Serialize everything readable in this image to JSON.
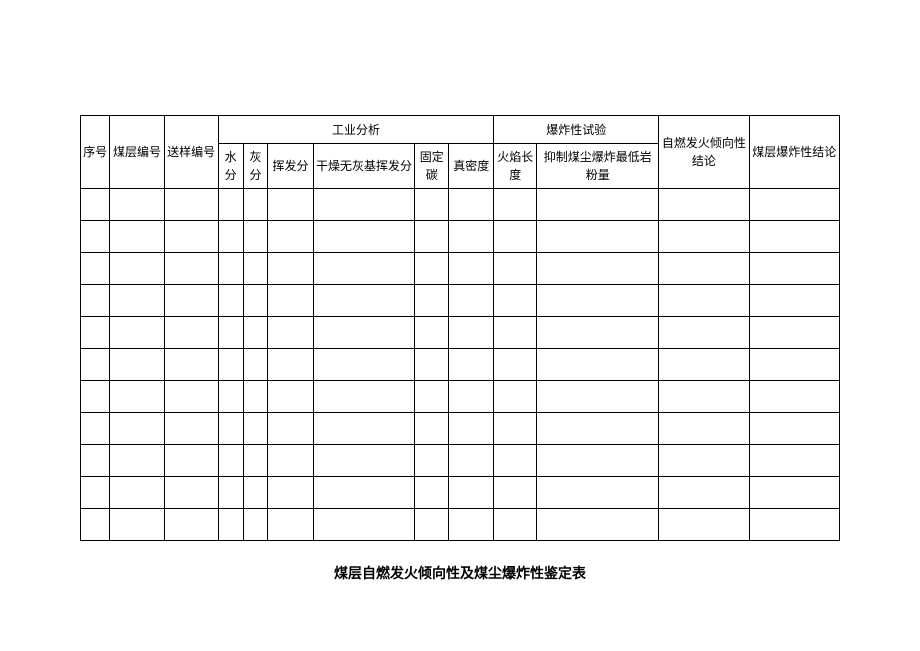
{
  "headers": {
    "row1": {
      "seq": "序号",
      "layer": "煤层编号",
      "sample": "送样编号",
      "industrial": "工业分析",
      "explosion": "爆炸性试验",
      "ignite": "自燃发火倾向性结论",
      "explodeResult": "煤层爆炸性结论"
    },
    "row2": {
      "water": "水分",
      "ash": "灰分",
      "volatile": "挥发分",
      "dry": "干燥无灰基挥发分",
      "carbon": "固定碳",
      "density": "真密度",
      "flame": "火焰长度",
      "rock": "抑制煤尘爆炸最低岩粉量"
    }
  },
  "caption": "煤层自燃发火倾向性及煤尘爆炸性鉴定表",
  "rowCount": 11
}
